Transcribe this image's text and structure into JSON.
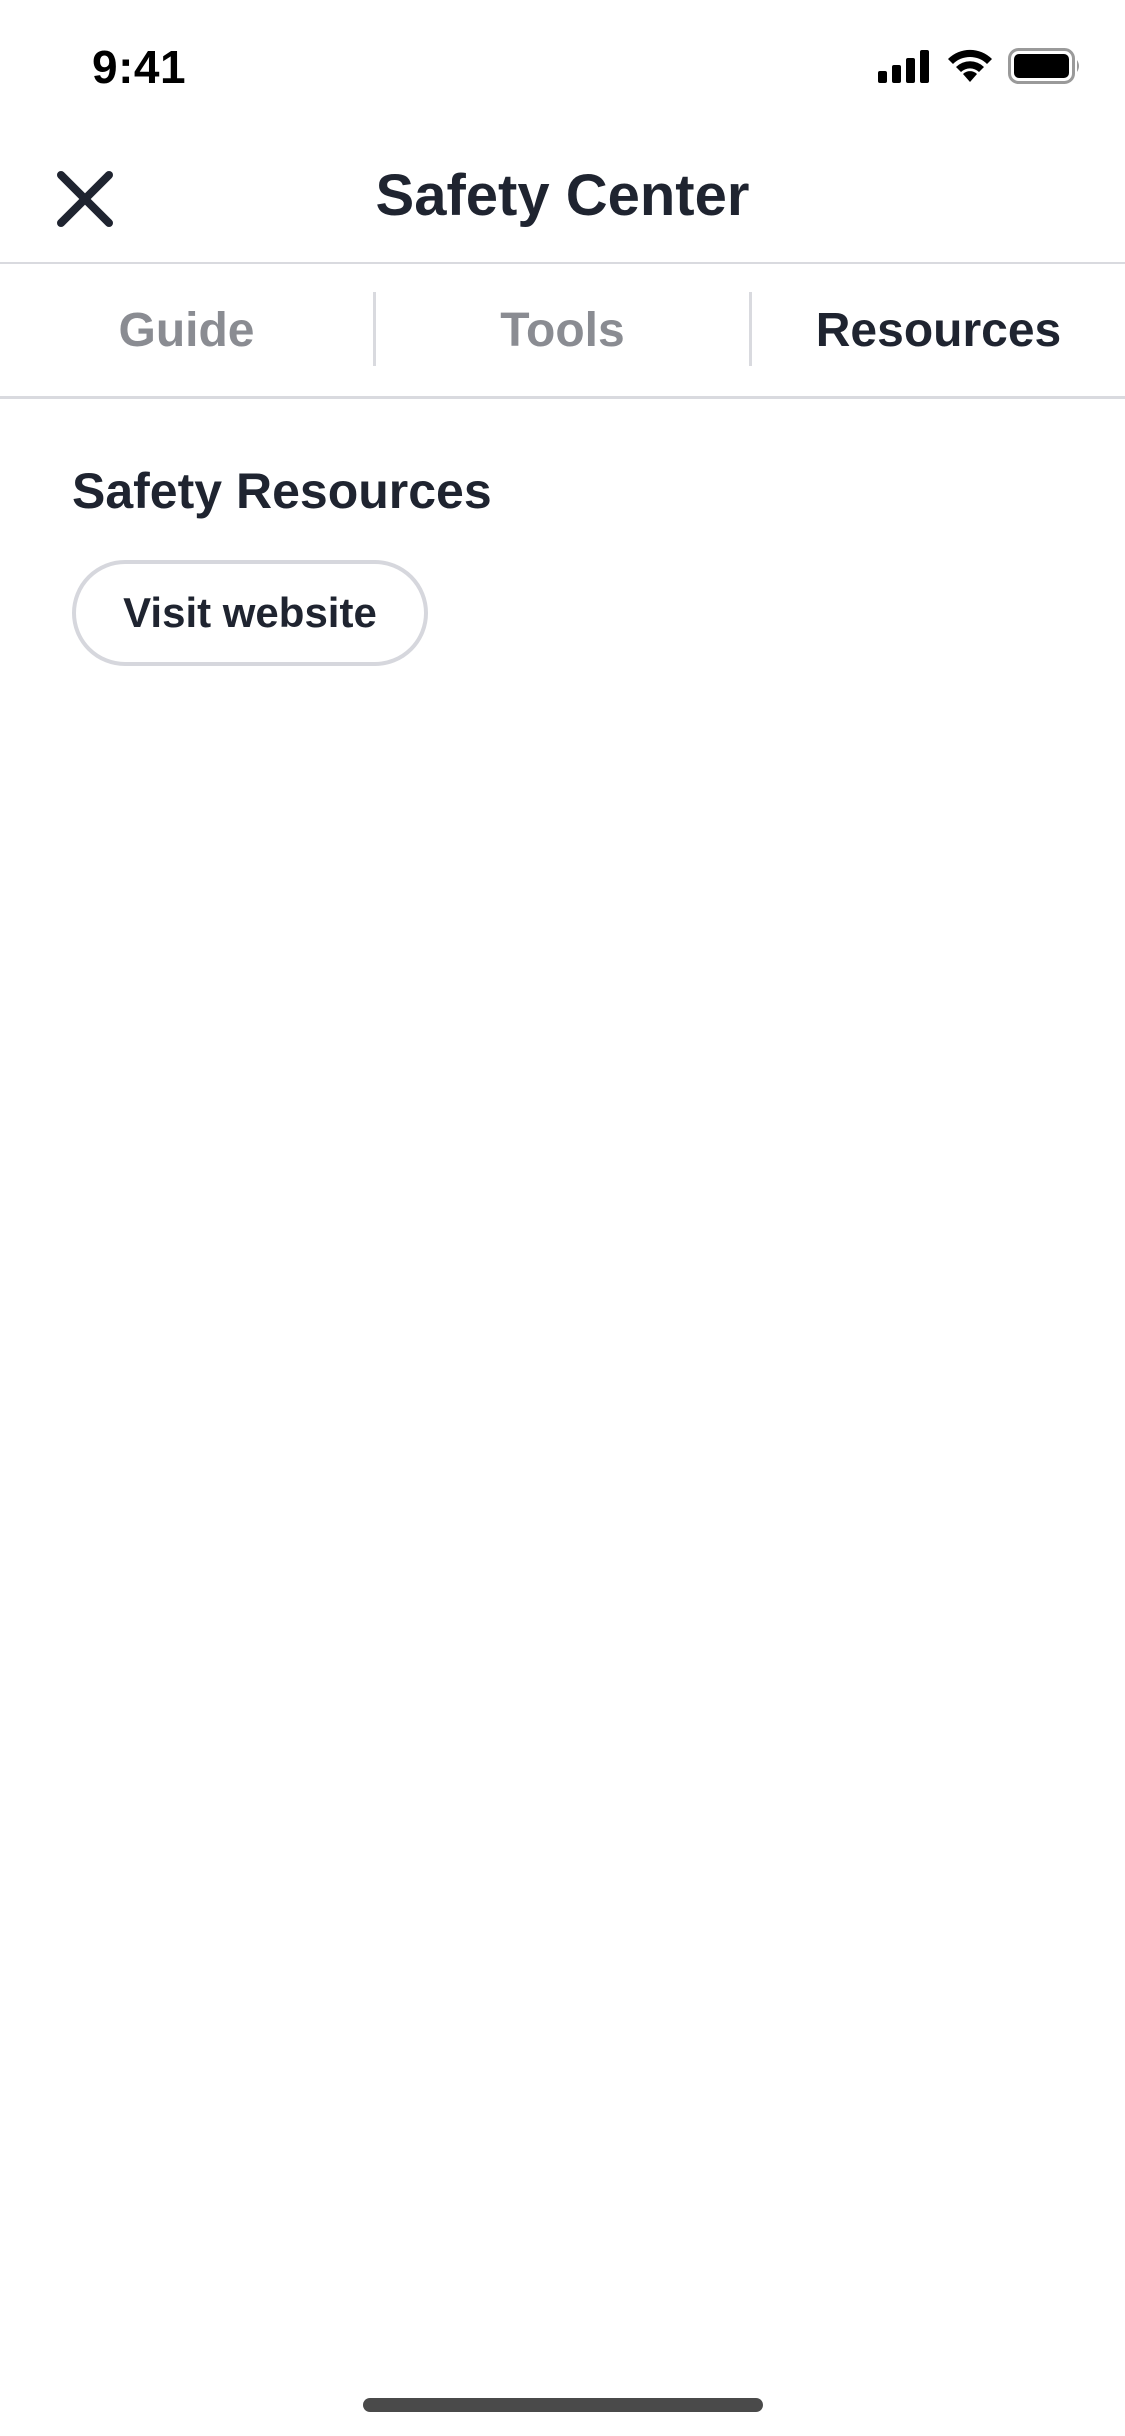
{
  "status_bar": {
    "time": "9:41",
    "icons": [
      "cellular-signal-icon",
      "wifi-icon",
      "battery-icon"
    ]
  },
  "nav": {
    "title": "Safety Center",
    "close_icon": "close-icon"
  },
  "tabs": [
    {
      "label": "Guide",
      "active": false
    },
    {
      "label": "Tools",
      "active": false
    },
    {
      "label": "Resources",
      "active": true
    }
  ],
  "content": {
    "section_title": "Safety Resources",
    "visit_button_label": "Visit website"
  },
  "colors": {
    "text_primary": "#1f2430",
    "text_inactive": "#8a8c92",
    "divider": "#d9dadf",
    "background": "#ffffff"
  }
}
